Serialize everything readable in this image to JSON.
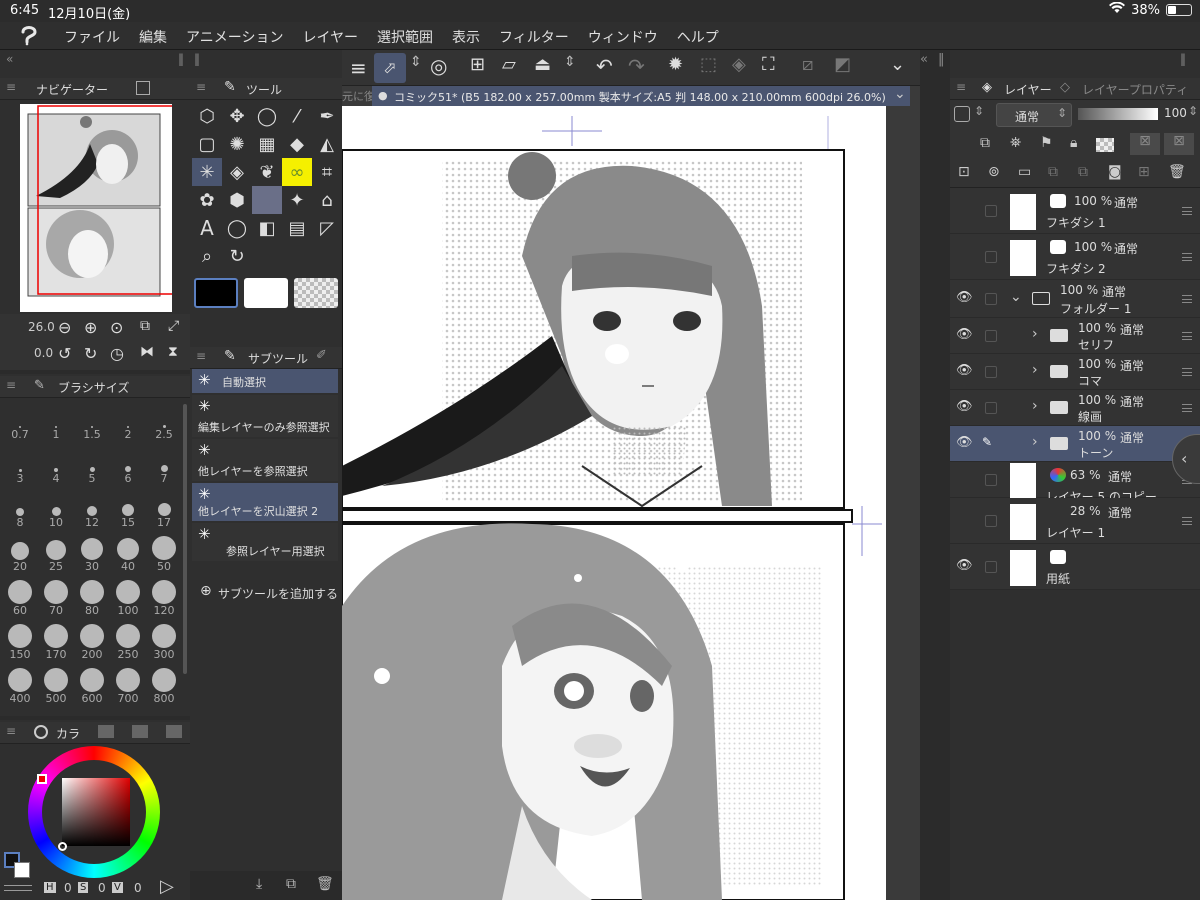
{
  "status": {
    "time": "6:45",
    "date": "12月10日(金)",
    "battery": "38%",
    "battery_level": 0.38
  },
  "menu": [
    "ファイル",
    "編集",
    "アニメーション",
    "レイヤー",
    "選択範囲",
    "表示",
    "フィルター",
    "ウィンドウ",
    "ヘルプ"
  ],
  "navigator": {
    "tab": "ナビゲーター",
    "zoom": "26.0",
    "rotation": "0.0"
  },
  "tool": {
    "tab": "ツール"
  },
  "subtool": {
    "tab": "サブツール",
    "items": [
      "自動選択",
      "編集レイヤーのみ参照選択",
      "他レイヤーを参照選択",
      "他レイヤーを沢山選択 2",
      "参照レイヤー用選択"
    ],
    "add": "サブツールを追加する"
  },
  "brushsize": {
    "tab": "ブラシサイズ",
    "sizes": [
      "0.7",
      "1",
      "1.5",
      "2",
      "2.5",
      "3",
      "4",
      "5",
      "6",
      "7",
      "8",
      "10",
      "12",
      "15",
      "17",
      "20",
      "25",
      "30",
      "40",
      "50",
      "60",
      "70",
      "80",
      "100",
      "120",
      "150",
      "170",
      "200",
      "250",
      "300",
      "400",
      "500",
      "600",
      "700",
      "800"
    ]
  },
  "color": {
    "tab": "カラ",
    "h": "0",
    "s": "0",
    "v": "0",
    "h_label": "H",
    "s_label": "S",
    "v_label": "V"
  },
  "canvas": {
    "tab_prefix": "元に復",
    "doc_title": "コミック51* (B5 182.00 x 257.00mm 製本サイズ:A5 判 148.00 x 210.00mm 600dpi 26.0%)"
  },
  "layers": {
    "tab": "レイヤー",
    "tab2": "レイヤープロパティ",
    "blend": "通常",
    "opacity": "100",
    "rows": [
      {
        "opacity": "100 %",
        "mode": "通常",
        "name": "フキダシ 1",
        "visible": false,
        "type": "balloon"
      },
      {
        "opacity": "100 %",
        "mode": "通常",
        "name": "フキダシ 2",
        "visible": false,
        "type": "balloon"
      },
      {
        "opacity": "100 %",
        "mode": "通常",
        "name": "フォルダー 1",
        "visible": true,
        "type": "folder-open"
      },
      {
        "opacity": "100 %",
        "mode": "通常",
        "name": "セリフ",
        "visible": true,
        "type": "folder"
      },
      {
        "opacity": "100 %",
        "mode": "通常",
        "name": "コマ",
        "visible": true,
        "type": "folder"
      },
      {
        "opacity": "100 %",
        "mode": "通常",
        "name": "線画",
        "visible": true,
        "type": "folder"
      },
      {
        "opacity": "100 %",
        "mode": "通常",
        "name": "トーン",
        "visible": true,
        "type": "folder"
      },
      {
        "opacity": "63 %",
        "mode": "通常",
        "name": "レイヤー 5 のコピー",
        "visible": false,
        "type": "raster"
      },
      {
        "opacity": "28 %",
        "mode": "通常",
        "name": "レイヤー 1",
        "visible": false,
        "type": "raster"
      },
      {
        "opacity": "",
        "mode": "",
        "name": "用紙",
        "visible": true,
        "type": "paper"
      }
    ]
  },
  "accent": "#4a5570",
  "highlight_tool": "#f5f000"
}
